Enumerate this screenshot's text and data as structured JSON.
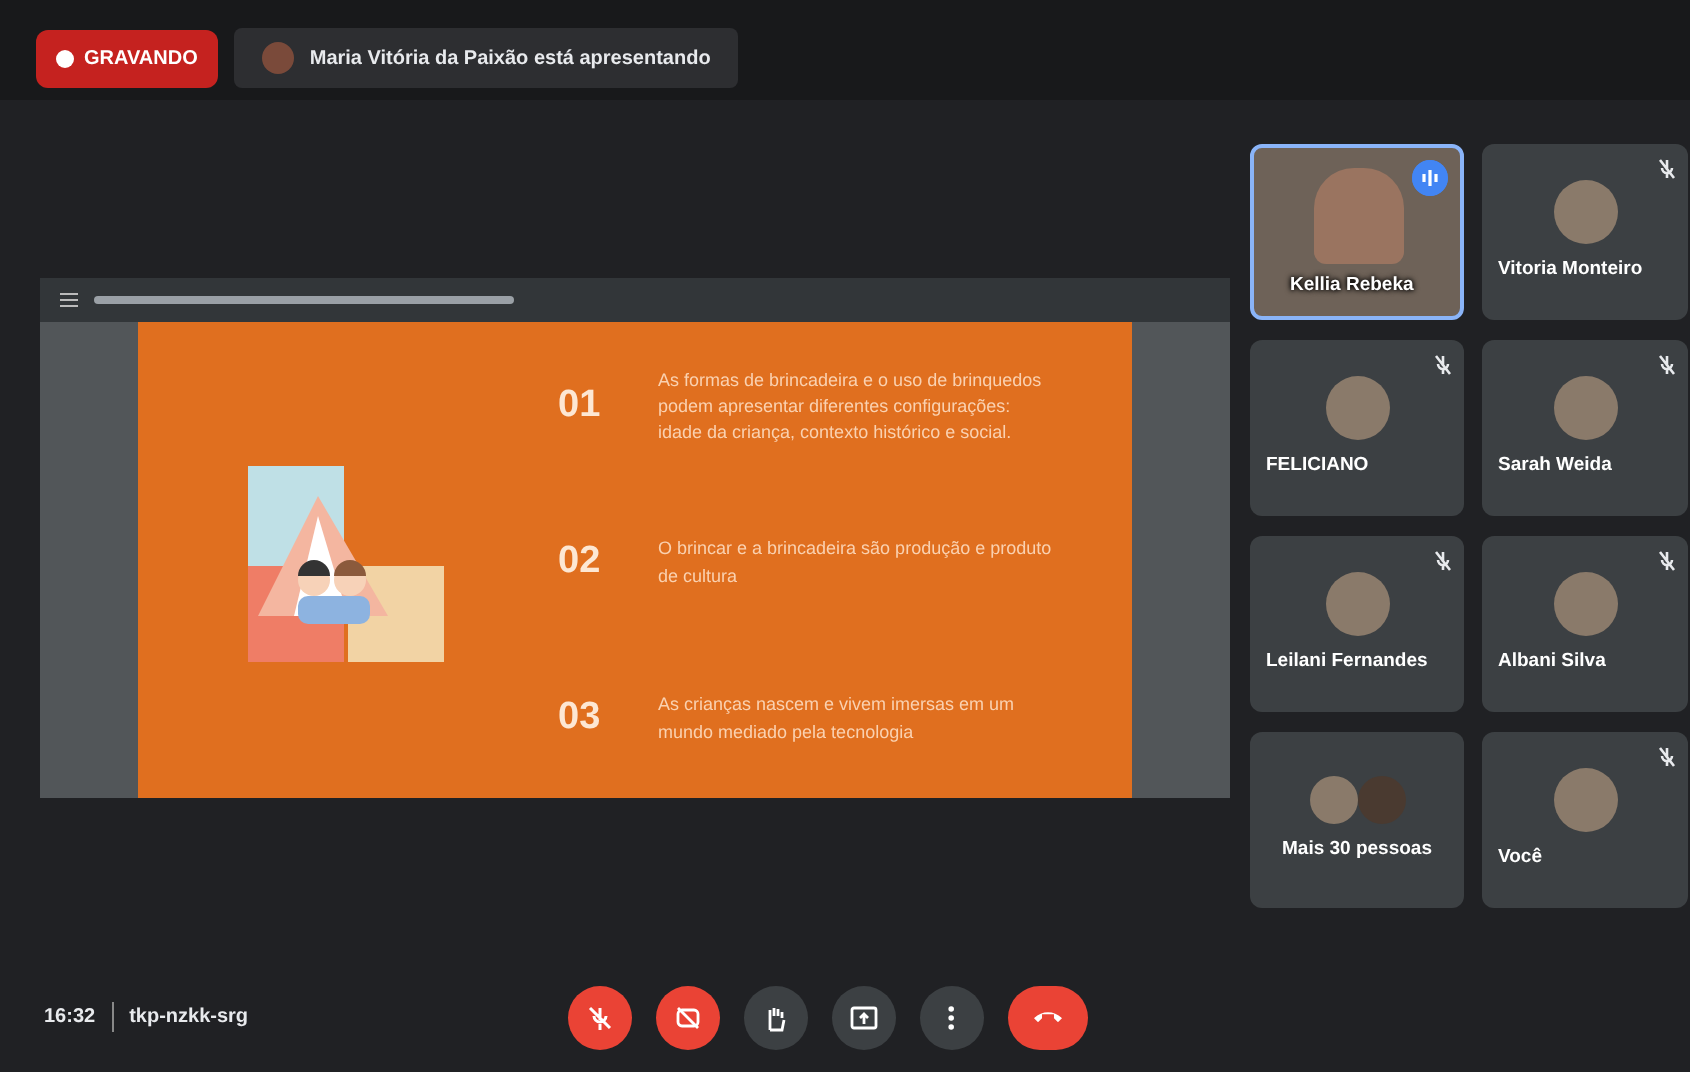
{
  "top_bar": {
    "recording_label": "GRAVANDO",
    "presenter_text": "Maria Vitória da Paixão está apresentando"
  },
  "slide": {
    "items": [
      {
        "number": "01",
        "text": "As formas de brincadeira e o uso de brinquedos podem apresentar diferentes configurações: idade da criança, contexto histórico e social."
      },
      {
        "number": "02",
        "text": "O brincar e a brincadeira são produção e produto de cultura"
      },
      {
        "number": "03",
        "text": "As crianças nascem e vivem imersas em um mundo mediado pela tecnologia"
      }
    ]
  },
  "participants": [
    {
      "name": "Kellia Rebeka",
      "kind": "video",
      "muted": false,
      "speaking": true
    },
    {
      "name": "Vitoria Monteiro",
      "kind": "avatar",
      "muted": true,
      "speaking": false
    },
    {
      "name": "FELICIANO",
      "kind": "avatar",
      "muted": true,
      "speaking": false
    },
    {
      "name": "Sarah Weida",
      "kind": "avatar",
      "muted": true,
      "speaking": false
    },
    {
      "name": "Leilani Fernandes",
      "kind": "avatar",
      "muted": true,
      "speaking": false
    },
    {
      "name": "Albani Silva",
      "kind": "avatar",
      "muted": true,
      "speaking": false
    },
    {
      "name": "Mais 30 pessoas",
      "kind": "group",
      "muted": false,
      "speaking": false
    },
    {
      "name": "Você",
      "kind": "avatar",
      "muted": true,
      "speaking": false
    }
  ],
  "bottom_bar": {
    "time": "16:32",
    "meeting_code": "tkp-nzkk-srg",
    "controls": [
      {
        "kind": "mic",
        "off": true
      },
      {
        "kind": "camera",
        "off": true
      },
      {
        "kind": "hand",
        "off": false
      },
      {
        "kind": "present",
        "off": false
      },
      {
        "kind": "more",
        "off": false
      },
      {
        "kind": "leave",
        "off": true
      }
    ]
  }
}
